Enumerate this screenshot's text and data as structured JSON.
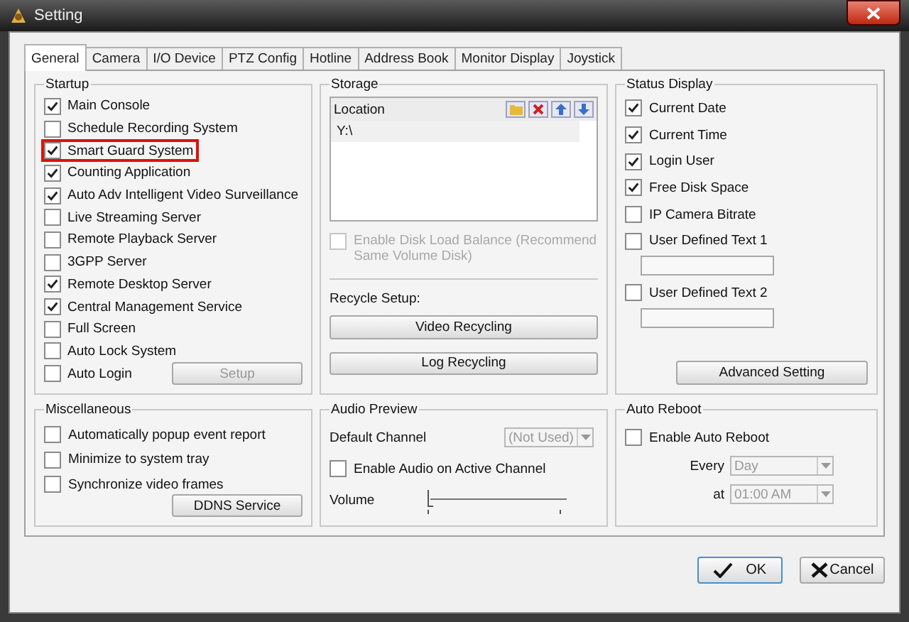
{
  "window": {
    "title": "Setting"
  },
  "tabs": [
    {
      "label": "General",
      "selected": true
    },
    {
      "label": "Camera",
      "selected": false
    },
    {
      "label": "I/O Device",
      "selected": false
    },
    {
      "label": "PTZ Config",
      "selected": false
    },
    {
      "label": "Hotline",
      "selected": false
    },
    {
      "label": "Address Book",
      "selected": false
    },
    {
      "label": "Monitor Display",
      "selected": false
    },
    {
      "label": "Joystick",
      "selected": false
    }
  ],
  "startup": {
    "title": "Startup",
    "items": [
      {
        "label": "Main Console",
        "checked": true,
        "highlighted": false
      },
      {
        "label": "Schedule Recording System",
        "checked": false,
        "highlighted": false
      },
      {
        "label": "Smart Guard System",
        "checked": true,
        "highlighted": true
      },
      {
        "label": "Counting Application",
        "checked": true,
        "highlighted": false
      },
      {
        "label": "Auto Adv Intelligent Video Surveillance",
        "checked": true,
        "highlighted": false
      },
      {
        "label": "Live Streaming Server",
        "checked": false,
        "highlighted": false
      },
      {
        "label": "Remote Playback Server",
        "checked": false,
        "highlighted": false
      },
      {
        "label": "3GPP Server",
        "checked": false,
        "highlighted": false
      },
      {
        "label": "Remote Desktop Server",
        "checked": true,
        "highlighted": false
      },
      {
        "label": "Central Management Service",
        "checked": true,
        "highlighted": false
      },
      {
        "label": "Full Screen",
        "checked": false,
        "highlighted": false
      },
      {
        "label": "Auto Lock System",
        "checked": false,
        "highlighted": false
      },
      {
        "label": "Auto Login",
        "checked": false,
        "highlighted": false
      }
    ],
    "setup_button": {
      "label": "Setup",
      "disabled": true
    }
  },
  "storage": {
    "title": "Storage",
    "list_header": "Location",
    "locations": [
      "Y:\\"
    ],
    "disk_load_balance": {
      "label": "Enable Disk Load Balance (Recommend Same Volume Disk)",
      "checked": false,
      "disabled": true
    },
    "recycle_label": "Recycle Setup:",
    "buttons": [
      "Video Recycling",
      "Log Recycling"
    ]
  },
  "status_display": {
    "title": "Status Display",
    "items": [
      {
        "label": "Current Date",
        "checked": true,
        "kind": "check"
      },
      {
        "label": "Current Time",
        "checked": true,
        "kind": "check"
      },
      {
        "label": "Login User",
        "checked": true,
        "kind": "check"
      },
      {
        "label": "Free Disk Space",
        "checked": true,
        "kind": "check"
      },
      {
        "label": "IP Camera Bitrate",
        "checked": false,
        "kind": "check"
      },
      {
        "label": "User Defined Text 1",
        "checked": false,
        "kind": "text"
      },
      {
        "label": "User Defined Text 2",
        "checked": false,
        "kind": "text"
      }
    ],
    "button": "Advanced Setting"
  },
  "miscellaneous": {
    "title": "Miscellaneous",
    "items": [
      {
        "label": "Automatically popup event report",
        "checked": false
      },
      {
        "label": "Minimize to system tray",
        "checked": false
      },
      {
        "label": "Synchronize video frames",
        "checked": false
      }
    ],
    "button": "DDNS Service"
  },
  "audio_preview": {
    "title": "Audio Preview",
    "default_channel_label": "Default Channel",
    "default_channel": "(Not Used)",
    "active_channel": {
      "label": "Enable Audio on Active Channel",
      "checked": false
    },
    "volume_label": "Volume",
    "volume": {
      "level": 0
    }
  },
  "auto_reboot": {
    "title": "Auto Reboot",
    "enable": {
      "label": "Enable Auto Reboot",
      "checked": false
    },
    "every_label": "Every",
    "every": "Day",
    "at_label": "at",
    "at": "01:00 AM"
  },
  "footer": {
    "ok": "OK",
    "cancel": "Cancel"
  }
}
